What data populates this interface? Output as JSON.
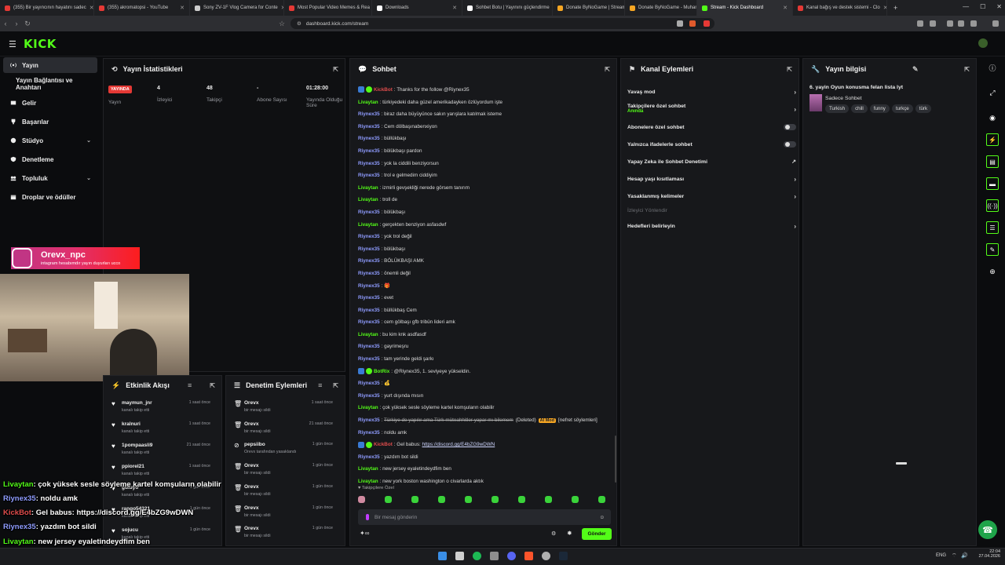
{
  "browser": {
    "tabs": [
      {
        "label": "(355) Bir yayıncının hayatını sadec",
        "color": "#e53935"
      },
      {
        "label": "(355) akromatopsi - YouTube",
        "color": "#e53935"
      },
      {
        "label": "Sony ZV-1F Vlog Camera for Conte",
        "color": "#cccccc"
      },
      {
        "label": "Most Popular Video Memes & Rea",
        "color": "#e53935"
      },
      {
        "label": "Downloads",
        "color": "#ffffff"
      },
      {
        "label": "Sohbet Botu | Yayınını güçlendirme",
        "color": "#ffffff"
      },
      {
        "label": "Donate ByNoGame | Streamer Sett",
        "color": "#f6a623"
      },
      {
        "label": "Donate ByNoGame - Muhammet",
        "color": "#f6a623"
      },
      {
        "label": "Stream - Kick Dashboard",
        "color": "#53fc18"
      },
      {
        "label": "Kanal bağış ve destek sistemi - Clo",
        "color": "#e53935"
      }
    ],
    "url": "dashboard.kick.com/stream",
    "new_tab": "+"
  },
  "logo": "KICK",
  "sidebar": {
    "items": [
      {
        "label": "Yayın",
        "icon": "broadcast-icon"
      },
      {
        "label": "Yayın Bağlantısı ve Anahtarı",
        "icon": ""
      },
      {
        "label": "Gelir",
        "icon": "money-icon"
      },
      {
        "label": "Başarılar",
        "icon": "trophy-icon"
      },
      {
        "label": "Stüdyo",
        "icon": "studio-icon"
      },
      {
        "label": "Denetleme",
        "icon": "shield-icon"
      },
      {
        "label": "Topluluk",
        "icon": "community-icon"
      },
      {
        "label": "Droplar ve ödüller",
        "icon": "gift-icon"
      }
    ]
  },
  "stats": {
    "title": "Yayın İstatistikleri",
    "live_badge": "YAYINDA",
    "live_label": "Yayın",
    "viewers_value": "4",
    "viewers_label": "İzleyici",
    "followers_value": "48",
    "followers_label": "Takipçi",
    "subs_value": "-",
    "subs_label": "Abone Sayısı",
    "uptime_value": "01:28:00",
    "uptime_label": "Yayında Olduğu Süre"
  },
  "instagram": {
    "handle": "Orevx_npc",
    "note": "intagram hesabımdır yayın duyurları ucco"
  },
  "chat": {
    "title": "Sohbet",
    "messages": [
      {
        "user": "KickBot",
        "cls": "k",
        "text": "Thanks for the follow @Riynex35",
        "badge": true
      },
      {
        "user": "Livaytan",
        "cls": "l",
        "text": "türkiyedeki daha güzel amerikadayken özlüyordum işte"
      },
      {
        "user": "Riynex35",
        "cls": "r",
        "text": "biraz daha büyüyünce sakın yarışlara katılmak isteme"
      },
      {
        "user": "Riynex35",
        "cls": "r",
        "text": "Cem dölbaşınabenxiyon"
      },
      {
        "user": "Riynex35",
        "cls": "r",
        "text": "büllükbaşı"
      },
      {
        "user": "Riynex35",
        "cls": "r",
        "text": "bölükbaşı pardon"
      },
      {
        "user": "Riynex35",
        "cls": "r",
        "text": "yok la ciddili benziyorsun"
      },
      {
        "user": "Riynex35",
        "cls": "r",
        "text": "trol e gelmedim ciddiyim"
      },
      {
        "user": "Livaytan",
        "cls": "l",
        "text": "izmirli gevşekliği nerede görsem tanırım"
      },
      {
        "user": "Livaytan",
        "cls": "l",
        "text": "troll de"
      },
      {
        "user": "Riynex35",
        "cls": "r",
        "text": "bölükbaşı"
      },
      {
        "user": "Livaytan",
        "cls": "l",
        "text": "gerçekten benziyon asfasdwf"
      },
      {
        "user": "Riynex35",
        "cls": "r",
        "text": "yok trol değil"
      },
      {
        "user": "Riynex35",
        "cls": "r",
        "text": "bölükbaşı"
      },
      {
        "user": "Riynex35",
        "cls": "r",
        "text": "BÖLÜKBAŞI AMK"
      },
      {
        "user": "Riynex35",
        "cls": "r",
        "text": "önemli değil"
      },
      {
        "user": "Riynex35",
        "cls": "r",
        "text": "🎁"
      },
      {
        "user": "Riynex35",
        "cls": "r",
        "text": "evet"
      },
      {
        "user": "Riynex35",
        "cls": "r",
        "text": "büllükbaş Cem"
      },
      {
        "user": "Riynex35",
        "cls": "r",
        "text": "cem gölbaşı gfb tribün lideri amk"
      },
      {
        "user": "Livaytan",
        "cls": "l",
        "text": "bu kim knk asdfasdf"
      },
      {
        "user": "Riynex35",
        "cls": "r",
        "text": "gayrimeşru"
      },
      {
        "user": "Riynex35",
        "cls": "r",
        "text": "tam yerinde geldi şarkı"
      },
      {
        "user": "BotRix",
        "cls": "b",
        "text": "@Riynex35, 1. seviyeye yükseldin.",
        "badge": true
      },
      {
        "user": "Riynex35",
        "cls": "r",
        "text": "💰"
      },
      {
        "user": "Riynex35",
        "cls": "r",
        "text": "yurt dışında mısın"
      },
      {
        "user": "Livaytan",
        "cls": "l",
        "text": "çok yüksek sesle söyleme kartel komşuların olabilir"
      },
      {
        "user": "Riynex35",
        "cls": "r",
        "text": "Türkiye de yapılır ama Türk müteahhitler yapar mı bilemem",
        "deleted": true
      },
      {
        "user": "Riynex35",
        "cls": "r",
        "text": "noldu amk"
      },
      {
        "user": "KickBot",
        "cls": "k",
        "text": "Gel babus: ",
        "link": "https://discord.gg/E4bZG9wDWN",
        "badge": true
      },
      {
        "user": "Riynex35",
        "cls": "r",
        "text": "yazdım bot sildi"
      },
      {
        "user": "Livaytan",
        "cls": "l",
        "text": "new jersey eyaletindeydfim ben"
      },
      {
        "user": "Livaytan",
        "cls": "l",
        "text": "new york boston washington o civarlarda aktık"
      }
    ],
    "deleted_label": "(Deleted)",
    "ai_mod_label": "AI Mod",
    "ai_mod_reason": "[nefret söylemleri]",
    "followers_only": "Takipçilere Özel",
    "input_placeholder": "Bir mesaj gönderin",
    "send_label": "Gönder"
  },
  "channel_actions": {
    "title": "Kanal Eylemleri",
    "slow_mode": "Yavaş mod",
    "followers_chat": "Takipçilere özel sohbet",
    "followers_chat_sub": "Anında",
    "subs_chat": "Abonelere özel sohbet",
    "emote_chat": "Yalnızca ifadelerle sohbet",
    "ai_mod": "Yapay Zeka ile Sohbet Denetimi",
    "age_limit": "Hesap yaşı kısıtlaması",
    "banned_words": "Yasaklanmış kelimeler",
    "viewer_guide": "İzleyici Yönlendir",
    "set_goals": "Hedefleri belirleyin"
  },
  "stream_info": {
    "title": "Yayın bilgisi",
    "stream_title": "6. yayin Oyun konusma felan lista lyt",
    "category": "Sadece Sohbet",
    "tags": [
      "Turkish",
      "chill",
      "funny",
      "turkçe",
      "türk"
    ]
  },
  "activity": {
    "title": "Etkinlik Akışı",
    "items": [
      {
        "name": "maymun_jnr",
        "sub": "kanalı takip etti",
        "time": "1 saat önce"
      },
      {
        "name": "kralnuri",
        "sub": "kanalı takip etti",
        "time": "1 saat önce"
      },
      {
        "name": "1pompaasli9",
        "sub": "kanalı takip etti",
        "time": "21 saat önce"
      },
      {
        "name": "ppiorel21",
        "sub": "kanalı takip etti",
        "time": "1 saat önce"
      },
      {
        "name": "guluyo",
        "sub": "kanalı takip etti",
        "time": "1 gün önce"
      },
      {
        "name": "rango54321",
        "sub": "kanalı takip etti",
        "time": "1 gün önce"
      },
      {
        "name": "sojucu",
        "sub": "kanalı takip etti",
        "time": "1 gün önce"
      }
    ]
  },
  "moderation": {
    "title": "Denetim Eylemleri",
    "items": [
      {
        "name": "Orevx",
        "sub": "bir mesajı sildi",
        "time": "1 saat önce"
      },
      {
        "name": "Orevx",
        "sub": "bir mesajı sildi",
        "time": "21 saat önce"
      },
      {
        "name": "pepsiibo",
        "sub": "Orevx tarafından yasaklandı",
        "time": "1 gün önce"
      },
      {
        "name": "Orevx",
        "sub": "bir mesajı sildi",
        "time": "1 gün önce"
      },
      {
        "name": "Orevx",
        "sub": "bir mesajı sildi",
        "time": "1 gün önce"
      },
      {
        "name": "Orevx",
        "sub": "bir mesajı sildi",
        "time": "1 gün önce"
      },
      {
        "name": "Orevx",
        "sub": "bir mesajı sildi",
        "time": "1 gün önce"
      }
    ]
  },
  "overlay_chat": [
    {
      "user": "Livaytan",
      "color": "#53fc18",
      "text": "çok yüksek sesle söyleme kartel komşuların olabilir"
    },
    {
      "user": "Riynex35",
      "color": "#8f9cff",
      "text": "noldu amk"
    },
    {
      "user": "KickBot",
      "color": "#e04c4c",
      "text": "Gel babus: https://discord.gg/E4bZG9wDWN"
    },
    {
      "user": "Riynex35",
      "color": "#8f9cff",
      "text": "yazdım bot sildi"
    },
    {
      "user": "Livaytan",
      "color": "#53fc18",
      "text": "new jersey eyaletindeydfim ben"
    },
    {
      "user": "Livaytan",
      "color": "#53fc18",
      "text": "new york boston washington o civarlarda aktık"
    }
  ],
  "taskbar": {
    "lang": "ENG",
    "time": "22:04",
    "date": "27.04.2026"
  },
  "colors": {
    "brand": "#53fc18",
    "panel": "#17181b",
    "bg": "#0b0c0e"
  }
}
